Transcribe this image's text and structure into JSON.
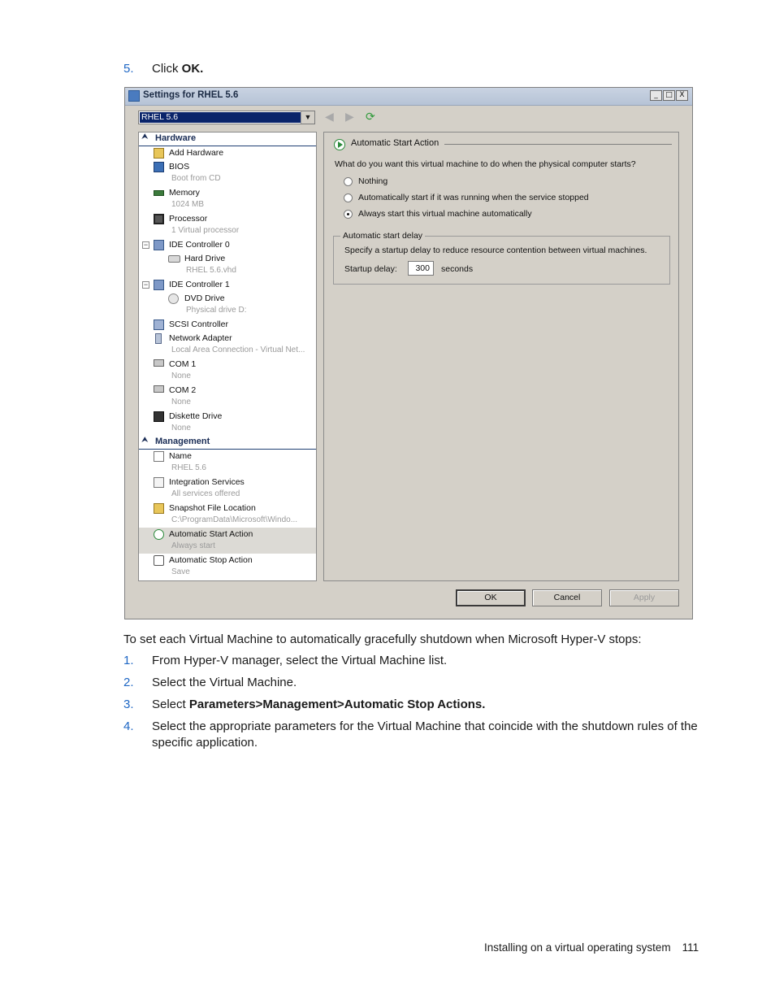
{
  "step5": {
    "num": "5.",
    "text": "Click ",
    "bold": "OK."
  },
  "dialog": {
    "title": "Settings for RHEL 5.6",
    "window_buttons": {
      "minimize": "_",
      "maximize": "□",
      "close": "X"
    },
    "vm_selector": "RHEL 5.6",
    "hardware": {
      "header": "Hardware",
      "items": [
        {
          "label": "Add Hardware",
          "sub": ""
        },
        {
          "label": "BIOS",
          "sub": "Boot from CD"
        },
        {
          "label": "Memory",
          "sub": "1024 MB"
        },
        {
          "label": "Processor",
          "sub": "1 Virtual processor"
        },
        {
          "label": "IDE Controller 0",
          "sub": ""
        },
        {
          "label": "Hard Drive",
          "sub": "RHEL 5.6.vhd"
        },
        {
          "label": "IDE Controller 1",
          "sub": ""
        },
        {
          "label": "DVD Drive",
          "sub": "Physical drive D:"
        },
        {
          "label": "SCSI Controller",
          "sub": ""
        },
        {
          "label": "Network Adapter",
          "sub": "Local Area Connection - Virtual Net..."
        },
        {
          "label": "COM 1",
          "sub": "None"
        },
        {
          "label": "COM 2",
          "sub": "None"
        },
        {
          "label": "Diskette Drive",
          "sub": "None"
        }
      ]
    },
    "management": {
      "header": "Management",
      "items": [
        {
          "label": "Name",
          "sub": "RHEL 5.6"
        },
        {
          "label": "Integration Services",
          "sub": "All services offered"
        },
        {
          "label": "Snapshot File Location",
          "sub": "C:\\ProgramData\\Microsoft\\Windo..."
        },
        {
          "label": "Automatic Start Action",
          "sub": "Always start"
        },
        {
          "label": "Automatic Stop Action",
          "sub": "Save"
        }
      ]
    },
    "panel": {
      "group_title": "Automatic Start Action",
      "question": "What do you want this virtual machine to do when the physical computer starts?",
      "options": [
        {
          "label": "Nothing",
          "selected": false
        },
        {
          "label": "Automatically start if it was running when the service stopped",
          "selected": false
        },
        {
          "label": "Always start this virtual machine automatically",
          "selected": true
        }
      ],
      "delay": {
        "legend": "Automatic start delay",
        "description": "Specify a startup delay to reduce resource contention between virtual machines.",
        "label": "Startup delay:",
        "value": "300",
        "unit": "seconds"
      }
    },
    "buttons": {
      "ok": "OK",
      "cancel": "Cancel",
      "apply": "Apply"
    }
  },
  "paragraph": "To set each Virtual Machine to automatically gracefully shutdown when Microsoft Hyper-V stops:",
  "steps": [
    {
      "num": "1.",
      "text": "From Hyper-V manager, select the Virtual Machine list."
    },
    {
      "num": "2.",
      "text": "Select the Virtual Machine."
    },
    {
      "num": "3.",
      "text": "Select ",
      "bold": "Parameters>Management>Automatic Stop Actions."
    },
    {
      "num": "4.",
      "line1": "Select the appropriate parameters for the Virtual Machine that coincide with the shutdown rules of the",
      "line2": "specific application."
    }
  ],
  "footer": {
    "text": "Installing on a virtual operating system",
    "page": "111"
  },
  "colors": {
    "step_number": "#1d66c4",
    "dialog_face": "#d4d0c8",
    "selection": "#0a246a"
  }
}
